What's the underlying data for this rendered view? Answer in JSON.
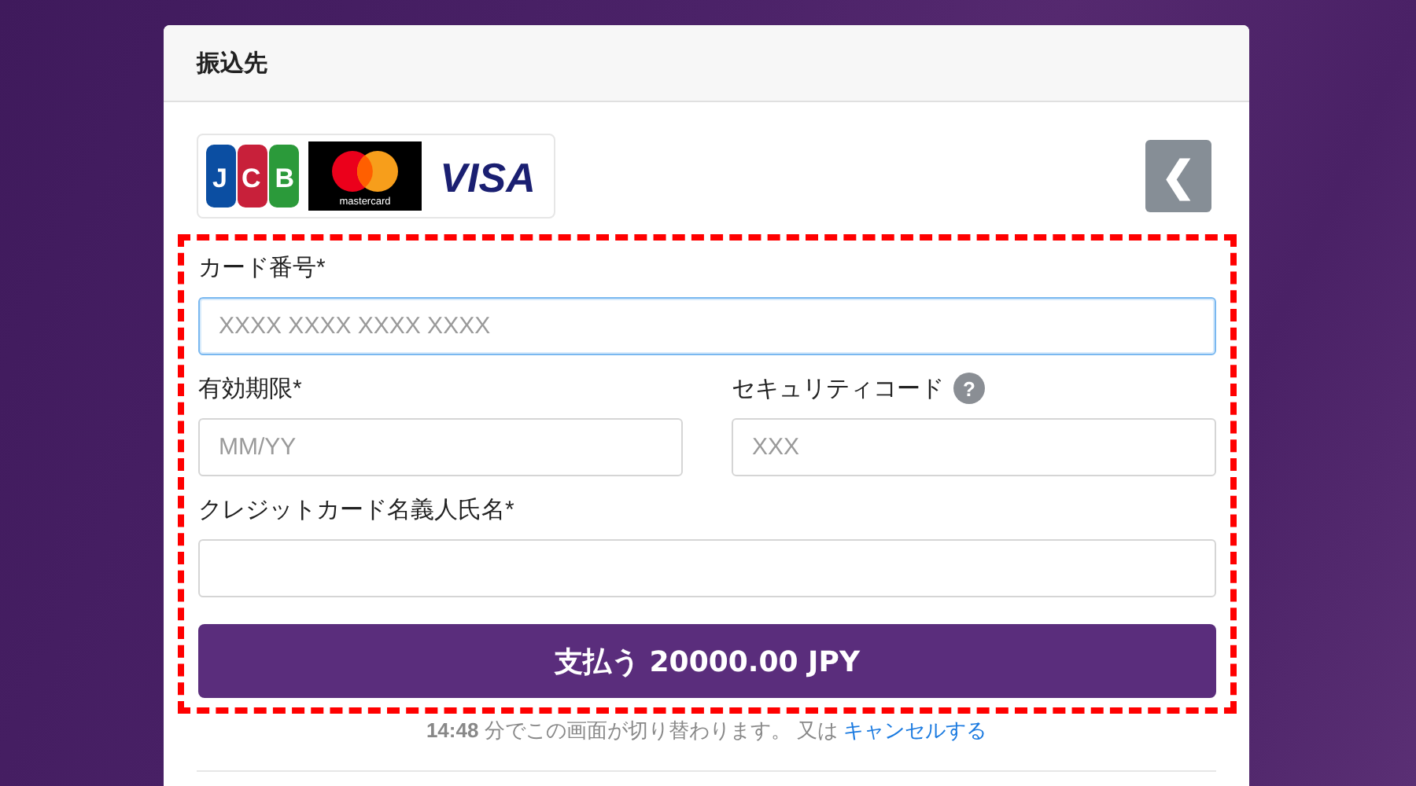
{
  "panel": {
    "title": "振込先"
  },
  "card_logos": [
    {
      "kind": "stripes",
      "text": "JCB"
    },
    {
      "kind": "circles",
      "text": "mastercard"
    },
    {
      "kind": "wordmark",
      "text": "VISA"
    }
  ],
  "back_button": {
    "glyph": "❮"
  },
  "fields": [
    {
      "label": "カード番号*",
      "placeholder": "XXXX XXXX XXXX XXXX",
      "focused": true,
      "kind": "full"
    },
    {
      "label": "有効期限*",
      "placeholder": "MM/YY",
      "focused": false,
      "kind": "half"
    },
    {
      "label": "セキュリティコード",
      "help": "?",
      "placeholder": "XXX",
      "focused": false,
      "kind": "half"
    },
    {
      "label": "クレジットカード名義人氏名*",
      "focused": false,
      "kind": "full"
    }
  ],
  "pay_button": "支払う 20000.00 JPY",
  "footer": {
    "text": "**14:48** 分でこの画面が切り替わります。 又は ",
    "link": "キャンセルする"
  }
}
